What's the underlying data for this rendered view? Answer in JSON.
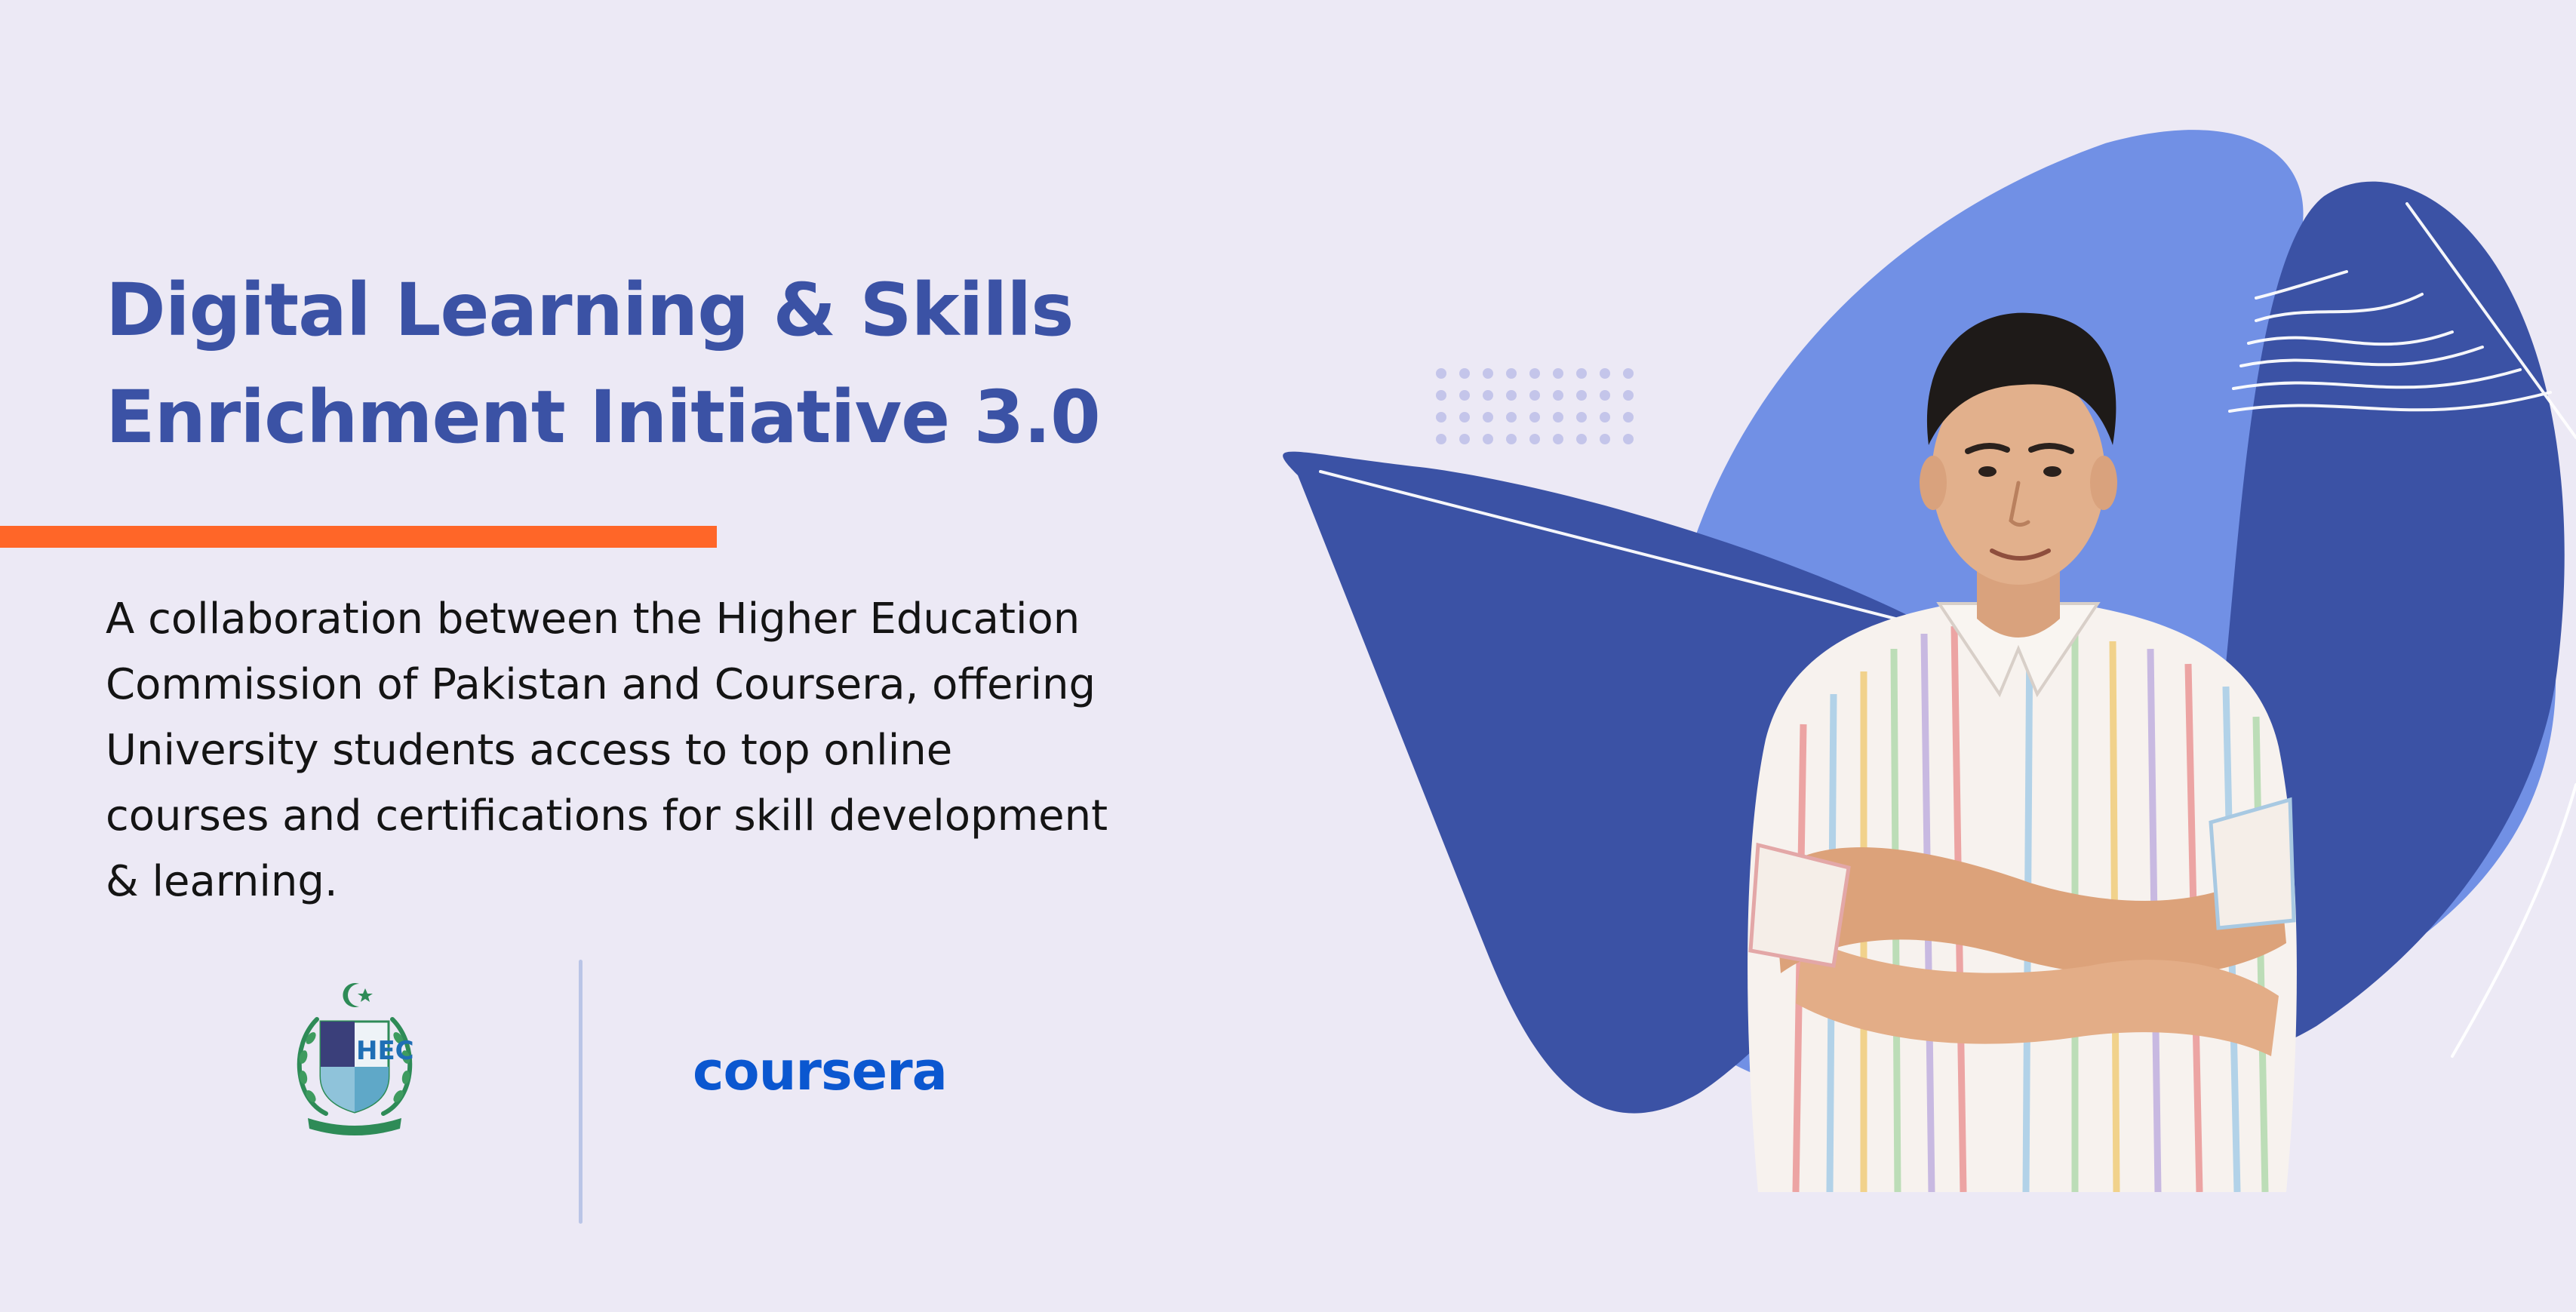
{
  "headline": {
    "lines": [
      "Digital Learning & Skills",
      "Enrichment Initiative 3.0"
    ],
    "color": "#3B52A5"
  },
  "accent_color": "#FF6628",
  "description": {
    "lines": [
      "A collaboration between the Higher Education",
      "Commission of Pakistan and Coursera, offering",
      "University students access to top online",
      "courses and certifications for skill development",
      "& learning."
    ]
  },
  "logos": {
    "hec": {
      "label": "HEC",
      "icon": "hec-emblem-icon",
      "color": "#2E8B57"
    },
    "coursera": {
      "label": "coursera",
      "color": "#0B57D0"
    }
  },
  "decor": {
    "blob_light": "#7190E5",
    "blob_dark": "#3B52A5",
    "dot_color": "#C4C5EA",
    "divider_color": "#A9B8E2"
  }
}
